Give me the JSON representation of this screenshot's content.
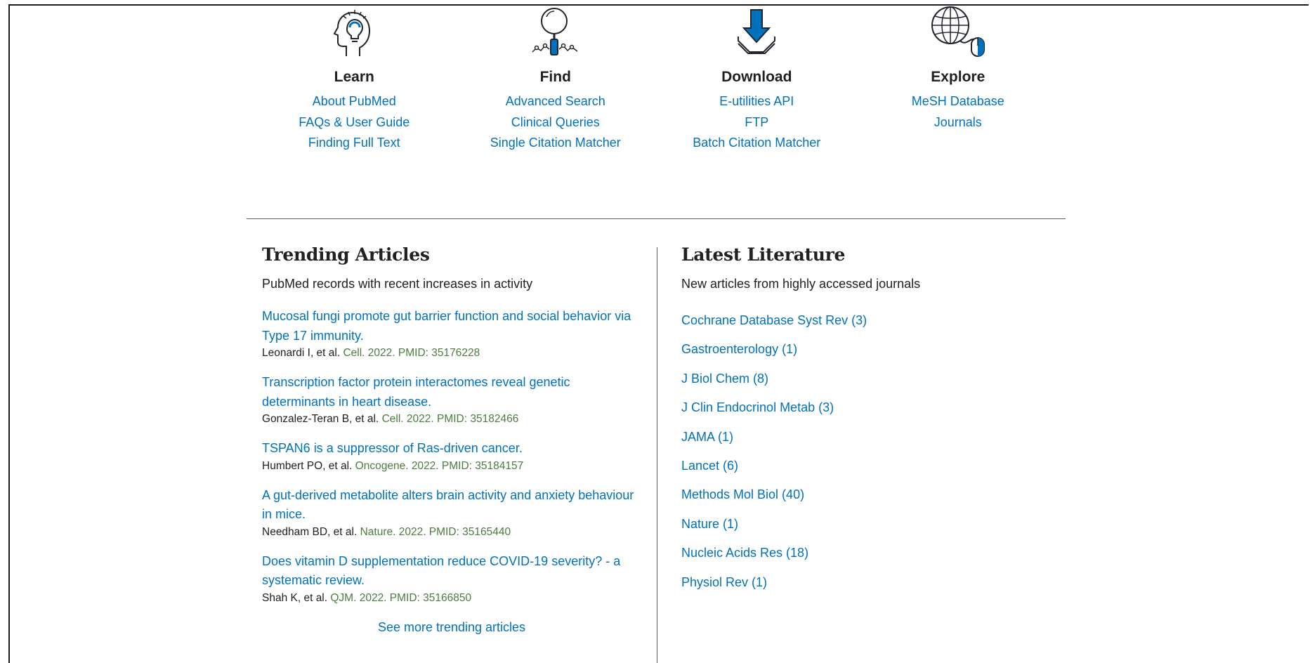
{
  "features": [
    {
      "icon": "learn-head-icon",
      "heading": "Learn",
      "links": [
        "About PubMed",
        "FAQs & User Guide",
        "Finding Full Text"
      ]
    },
    {
      "icon": "find-magnifier-icon",
      "heading": "Find",
      "links": [
        "Advanced Search",
        "Clinical Queries",
        "Single Citation Matcher"
      ]
    },
    {
      "icon": "download-arrow-icon",
      "heading": "Download",
      "links": [
        "E-utilities API",
        "FTP",
        "Batch Citation Matcher"
      ]
    },
    {
      "icon": "explore-globe-mouse-icon",
      "heading": "Explore",
      "links": [
        "MeSH Database",
        "Journals"
      ]
    }
  ],
  "trending": {
    "heading": "Trending Articles",
    "description": "PubMed records with recent increases in activity",
    "articles": [
      {
        "title": "Mucosal fungi promote gut barrier function and social behavior via Type 17 immunity.",
        "authors": "Leonardi I, et al.",
        "journal": "Cell. 2022. PMID: 35176228"
      },
      {
        "title": "Transcription factor protein interactomes reveal genetic determinants in heart disease.",
        "authors": "Gonzalez-Teran B, et al.",
        "journal": "Cell. 2022. PMID: 35182466"
      },
      {
        "title": "TSPAN6 is a suppressor of Ras-driven cancer.",
        "authors": "Humbert PO, et al.",
        "journal": "Oncogene. 2022. PMID: 35184157"
      },
      {
        "title": "A gut-derived metabolite alters brain activity and anxiety behaviour in mice.",
        "authors": "Needham BD, et al.",
        "journal": "Nature. 2022. PMID: 35165440"
      },
      {
        "title": "Does vitamin D supplementation reduce COVID-19 severity? - a systematic review.",
        "authors": "Shah K, et al.",
        "journal": "QJM. 2022. PMID: 35166850"
      }
    ],
    "see_more": "See more trending articles"
  },
  "latest": {
    "heading": "Latest Literature",
    "description": "New articles from highly accessed journals",
    "journals": [
      "Cochrane Database Syst Rev (3)",
      "Gastroenterology (1)",
      "J Biol Chem (8)",
      "J Clin Endocrinol Metab (3)",
      "JAMA (1)",
      "Lancet (6)",
      "Methods Mol Biol (40)",
      "Nature (1)",
      "Nucleic Acids Res (18)",
      "Physiol Rev (1)"
    ]
  },
  "colors": {
    "link": "#0071bc",
    "journal_meta": "#4b7d3f",
    "icon_accent": "#0071bc",
    "icon_stroke": "#20252b"
  }
}
